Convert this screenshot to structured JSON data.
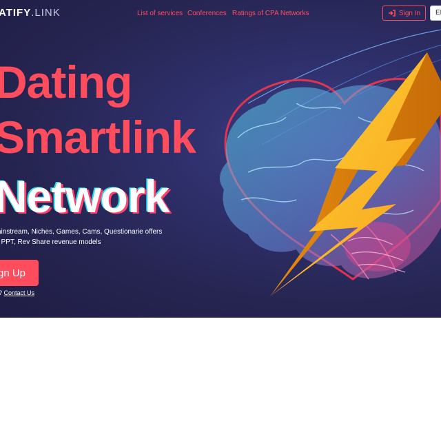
{
  "header": {
    "logo_main": "ATIFY",
    "logo_suffix": ".LINK",
    "nav": [
      {
        "label": "List of services"
      },
      {
        "label": "Conferences"
      },
      {
        "label": "Ratings of CPA Networks"
      }
    ],
    "sign_in_label": "Sign In",
    "language": "EN"
  },
  "hero": {
    "title_line1": "Dating",
    "title_line2": "Smartlink",
    "title_line3": "Network",
    "subtitle_line1": "ainstream, Niches, Games, Cams, Questionarie offers",
    "subtitle_line2": ", PPT, Rev Share revenue models",
    "sign_up_label": "gn Up",
    "contact_prefix": "?",
    "contact_link": "Contact Us"
  },
  "colors": {
    "accent": "#ff4d5e",
    "hero_background": "#262552",
    "bolt": "#ffc21a",
    "heart": "#e2344f",
    "brain_cyan": "#4fd6e8",
    "brain_pink": "#e0478f"
  },
  "icons": {
    "sign_in": "sign-in-icon",
    "illustration": "heart-brain-lightning-illustration"
  }
}
